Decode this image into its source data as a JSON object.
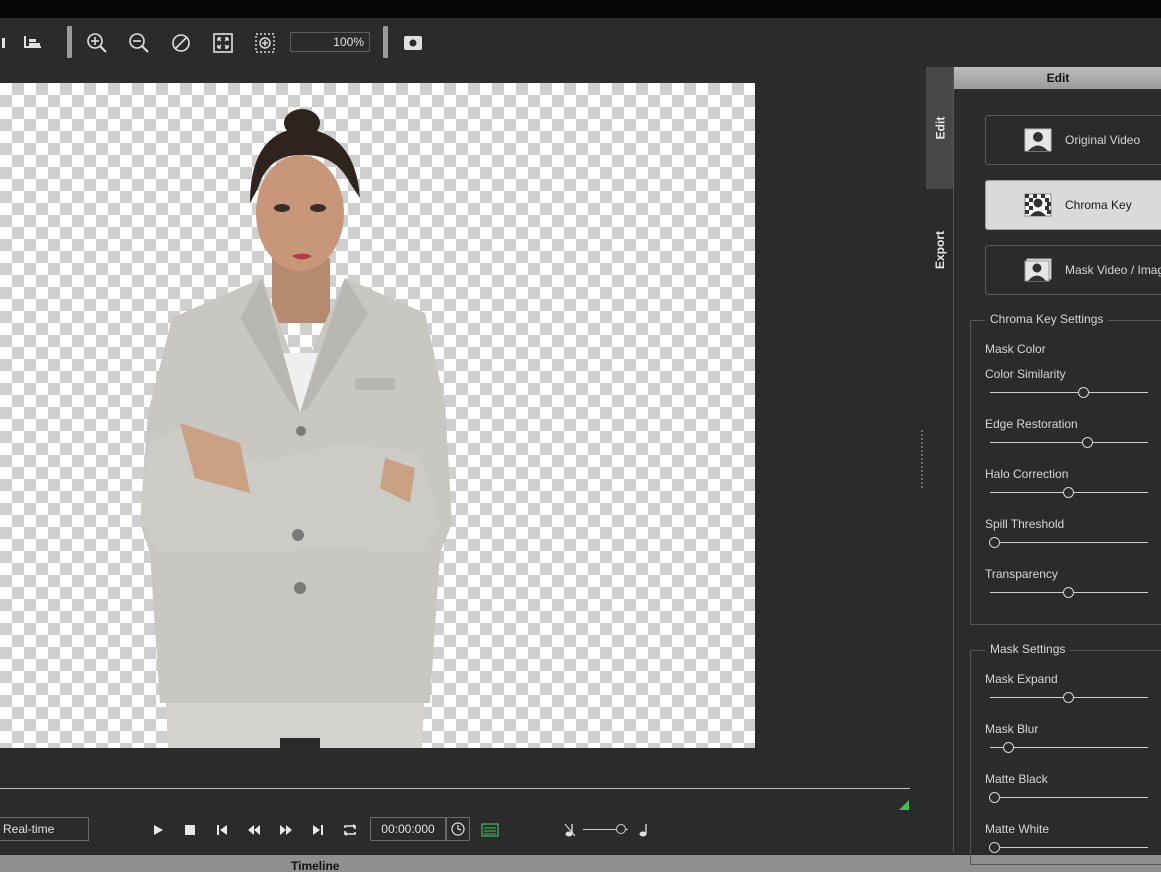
{
  "toolbar": {
    "zoom_value": "100%",
    "icons": [
      "partial-left-icon",
      "align-bottom-icon",
      "zoom-in-icon",
      "zoom-out-icon",
      "reset-zoom-icon",
      "fit-view-icon",
      "actual-size-icon",
      "snapshot-icon"
    ]
  },
  "canvas": {
    "subject": "woman-in-light-grey-suit"
  },
  "playback": {
    "mode": "Real-time",
    "time": "00:00:000",
    "icons": [
      "play-icon",
      "stop-icon",
      "previous-icon",
      "rewind-icon",
      "fast-forward-icon",
      "next-icon",
      "loop-icon",
      "clock-icon",
      "list-icon",
      "note-slow-icon",
      "note-fast-icon"
    ],
    "speed_level": 0.85
  },
  "timeline": {
    "title": "Timeline"
  },
  "side_tabs": {
    "edit": "Edit",
    "export": "Export"
  },
  "panel": {
    "header": "Edit",
    "modes": [
      {
        "label": "Original Video",
        "icon": "person-icon",
        "active": false
      },
      {
        "label": "Chroma Key",
        "icon": "chroma-key-icon",
        "active": true
      },
      {
        "label": "Mask Video / Image",
        "icon": "mask-video-icon",
        "active": false
      }
    ],
    "chroma_key": {
      "title": "Chroma Key Settings",
      "mask_color_label": "Mask Color",
      "sliders": [
        {
          "label": "Color Similarity",
          "value": 0.595
        },
        {
          "label": "Edge Restoration",
          "value": 0.62
        },
        {
          "label": "Halo Correction",
          "value": 0.5
        },
        {
          "label": "Spill Threshold",
          "value": 0.03
        },
        {
          "label": "Transparency",
          "value": 0.5
        }
      ]
    },
    "mask": {
      "title": "Mask Settings",
      "sliders": [
        {
          "label": "Mask Expand",
          "value": 0.5
        },
        {
          "label": "Mask Blur",
          "value": 0.12
        },
        {
          "label": "Matte Black",
          "value": 0.03
        },
        {
          "label": "Matte White",
          "value": 0.03
        }
      ]
    }
  },
  "colors": {
    "accent_green": "#3fbf55",
    "panel_bg": "#2b2b2b"
  }
}
